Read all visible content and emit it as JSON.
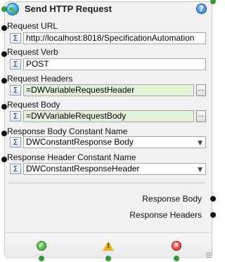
{
  "title": "Send HTTP Request",
  "help_symbol": "?",
  "fields": [
    {
      "label": "Request URL",
      "value": "http://localhost:8018/SpecificationAutomation",
      "kind": "text"
    },
    {
      "label": "Request Verb",
      "value": "POST",
      "kind": "text"
    },
    {
      "label": "Request Headers",
      "value": "=DWVariableRequestHeader",
      "kind": "variable"
    },
    {
      "label": "Request Body",
      "value": "=DWVariableRequestBody",
      "kind": "variable"
    },
    {
      "label": "Response Body Constant Name",
      "value": "DWConstantResponse Body",
      "kind": "select"
    },
    {
      "label": "Response Header Constant Name",
      "value": "DWConstantResponseHeader",
      "kind": "select"
    }
  ],
  "sigma_symbol": "Σ",
  "ellipsis_label": "...",
  "outputs": [
    {
      "label": "Response Body"
    },
    {
      "label": "Response Headers"
    }
  ],
  "footer": {
    "ok_symbol": "✓",
    "warning_symbol": "!",
    "error_symbol": "✕"
  },
  "colors": {
    "variable_background": "#e3f3da",
    "connector_green": "#2e9b3a",
    "connector_black": "#111111"
  }
}
